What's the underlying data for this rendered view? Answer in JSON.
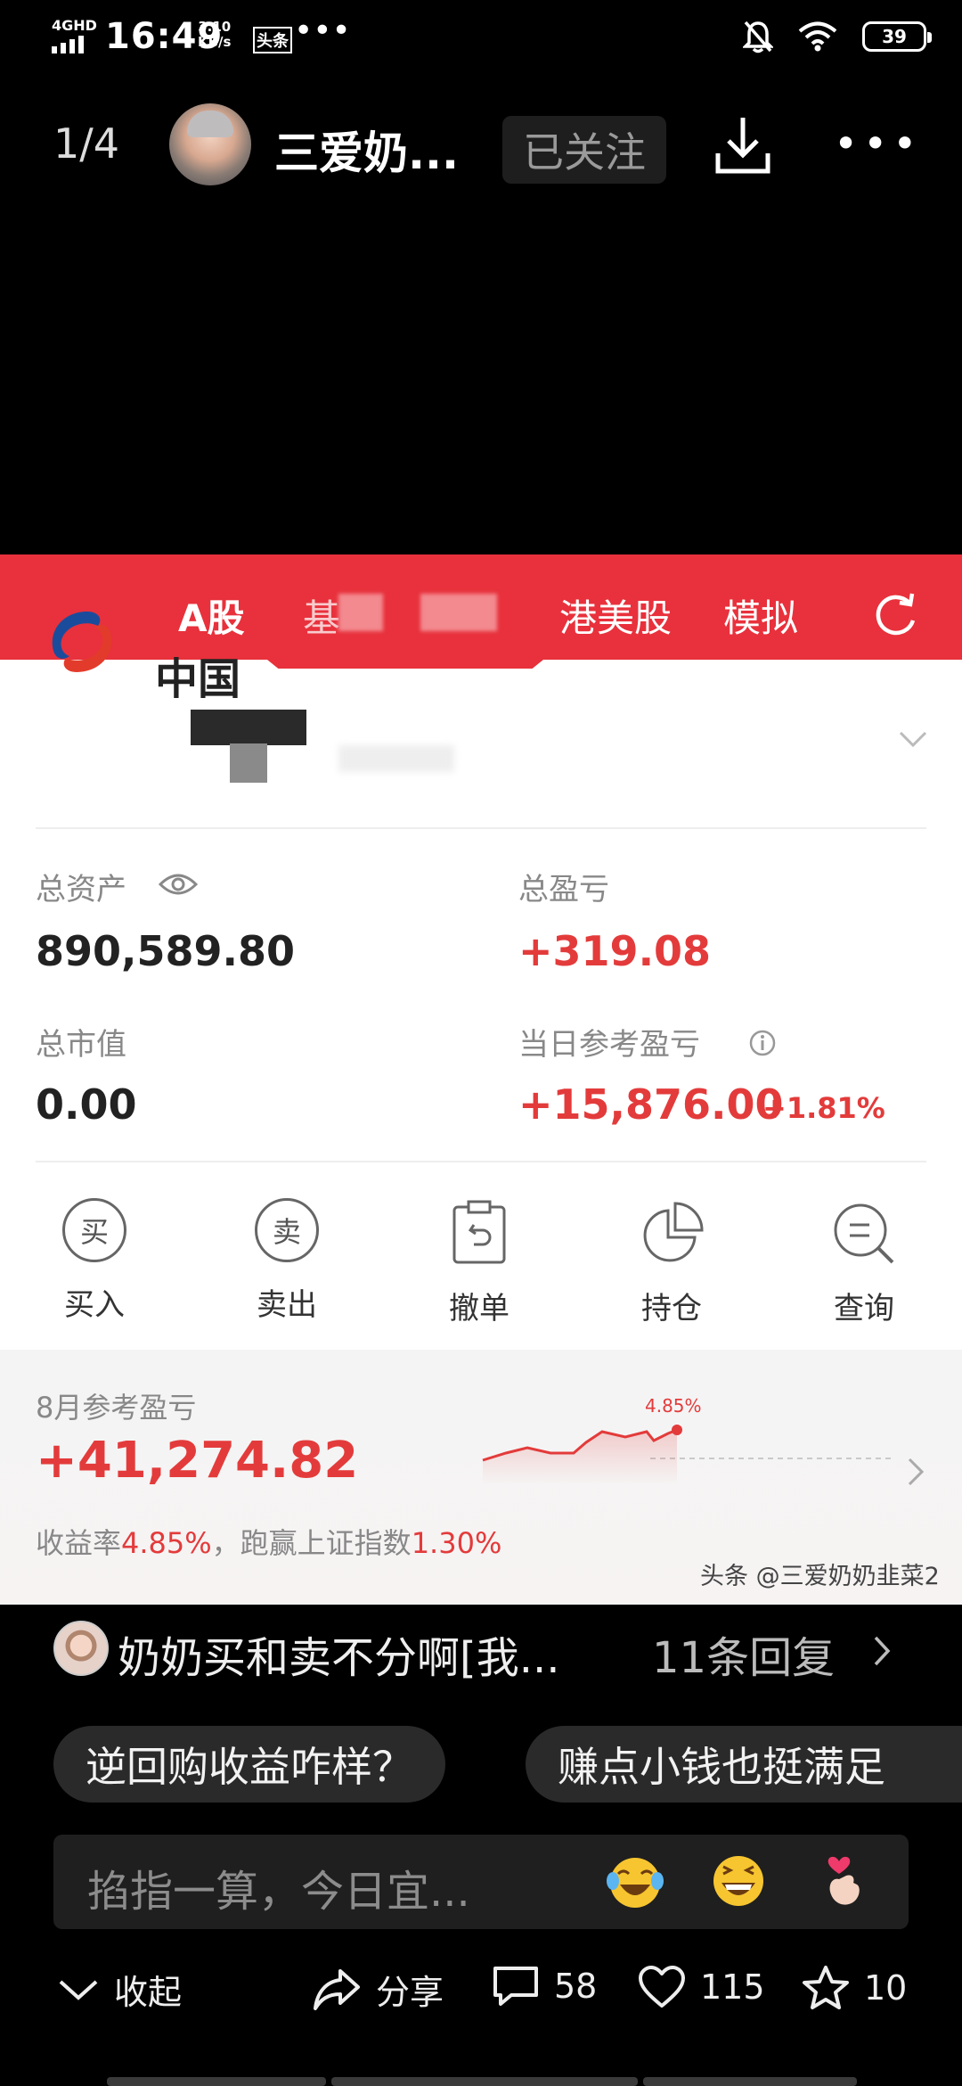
{
  "status_bar": {
    "network": "4GHD",
    "time": "16:49",
    "speed_value": "3.10",
    "speed_unit": "KB/s",
    "app_badge": "头条",
    "more": "•••",
    "battery": "39"
  },
  "top_bar": {
    "page_indicator": "1/4",
    "author_name": "三爱奶...",
    "follow_label": "已关注"
  },
  "screenshot": {
    "tabs": [
      "A股",
      "基",
      "港美股",
      "模拟"
    ],
    "account_name": "中国",
    "total_assets_label": "总资产",
    "total_assets_value": "890,589.80",
    "total_pnl_label": "总盈亏",
    "total_pnl_value": "+319.08",
    "market_value_label": "总市值",
    "market_value_value": "0.00",
    "daily_pnl_label": "当日参考盈亏",
    "daily_pnl_value": "+15,876.00",
    "daily_pnl_pct": "+1.81%",
    "actions": [
      {
        "label": "买入",
        "icon_char": "买"
      },
      {
        "label": "卖出",
        "icon_char": "卖"
      },
      {
        "label": "撤单"
      },
      {
        "label": "持仓"
      },
      {
        "label": "查询"
      }
    ],
    "monthly": {
      "label": "8月参考盈亏",
      "value": "+41,274.82",
      "return_label": "收益率",
      "return_value": "4.85%",
      "compare_label": "，跑赢上证指数",
      "compare_value": "1.30%",
      "chart_end_label": "4.85%"
    },
    "watermark": "头条 @三爱奶奶韭菜2",
    "accent_color": "#e8313c"
  },
  "comment_preview": {
    "text": "奶奶买和卖不分啊[我...",
    "replies": "11条回复"
  },
  "suggestions": [
    "逆回购收益咋样？",
    "赚点小钱也挺满足"
  ],
  "comment_input": {
    "placeholder": "掐指一算，今日宜..."
  },
  "bottom_bar": {
    "collapse": "收起",
    "share": "分享",
    "comments": "58",
    "likes": "115",
    "favorites": "10"
  }
}
